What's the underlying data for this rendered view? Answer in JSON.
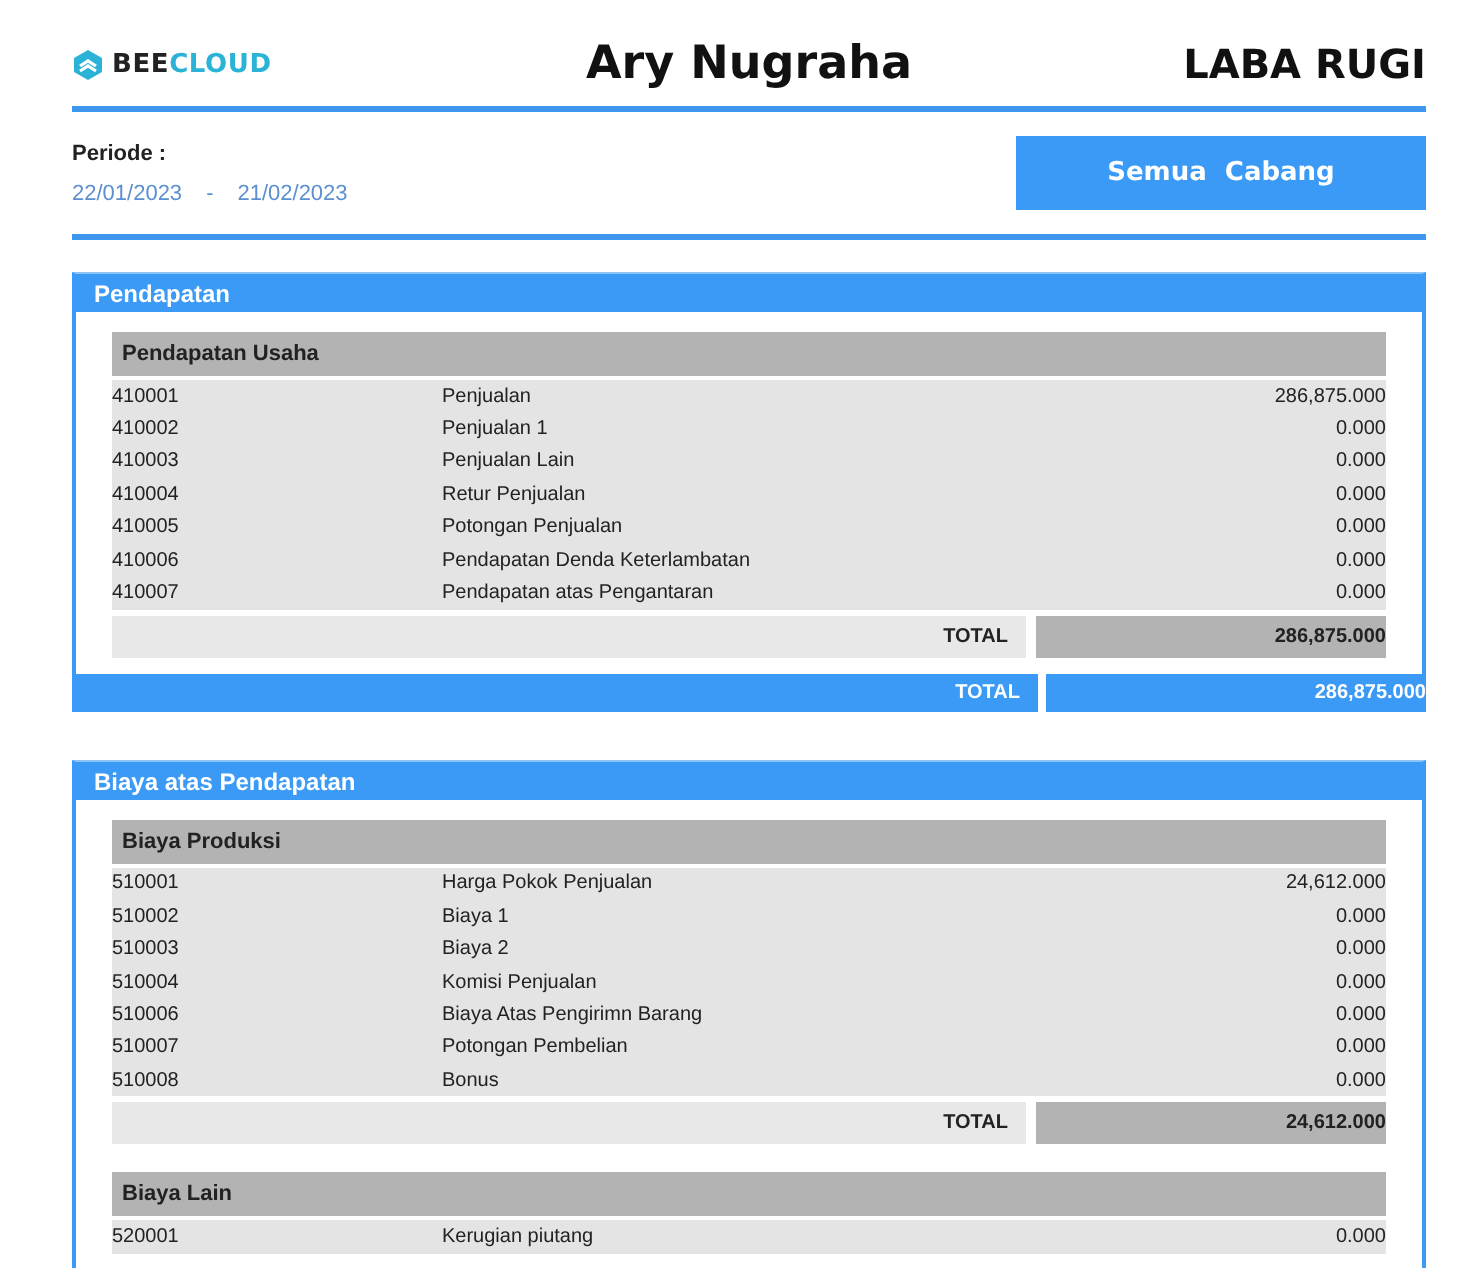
{
  "header": {
    "logo": {
      "first": "BEE",
      "second": "CLOUD"
    },
    "owner": "Ary Nugraha",
    "title": "LABA RUGI"
  },
  "period": {
    "label": "Periode :",
    "start": "22/01/2023",
    "separator": "-",
    "end": "21/02/2023"
  },
  "branch_button": "Semua  Cabang",
  "sections": [
    {
      "title": "Pendapatan",
      "groups": [
        {
          "title": "Pendapatan Usaha",
          "rows": [
            {
              "code": "410001",
              "name": "Penjualan",
              "amount": "286,875.000"
            },
            {
              "code": "410002",
              "name": "Penjualan 1",
              "amount": "0.000"
            },
            {
              "code": "410003",
              "name": "Penjualan Lain",
              "amount": "0.000"
            },
            {
              "code": "410004",
              "name": "Retur Penjualan",
              "amount": "0.000"
            },
            {
              "code": "410005",
              "name": "Potongan Penjualan",
              "amount": "0.000"
            },
            {
              "code": "410006",
              "name": "Pendapatan Denda Keterlambatan",
              "amount": "0.000"
            },
            {
              "code": "410007",
              "name": "Pendapatan atas Pengantaran",
              "amount": "0.000"
            }
          ],
          "total_label": "TOTAL",
          "total": "286,875.000"
        }
      ],
      "total_label": "TOTAL",
      "total": "286,875.000"
    },
    {
      "title": "Biaya atas Pendapatan",
      "groups": [
        {
          "title": "Biaya Produksi",
          "rows": [
            {
              "code": "510001",
              "name": "Harga Pokok Penjualan",
              "amount": "24,612.000"
            },
            {
              "code": "510002",
              "name": "Biaya 1",
              "amount": "0.000"
            },
            {
              "code": "510003",
              "name": "Biaya 2",
              "amount": "0.000"
            },
            {
              "code": "510004",
              "name": "Komisi Penjualan",
              "amount": "0.000"
            },
            {
              "code": "510006",
              "name": "Biaya Atas Pengirimn Barang",
              "amount": "0.000"
            },
            {
              "code": "510007",
              "name": "Potongan Pembelian",
              "amount": "0.000"
            },
            {
              "code": "510008",
              "name": "Bonus",
              "amount": "0.000"
            }
          ],
          "total_label": "TOTAL",
          "total": "24,612.000"
        },
        {
          "title": "Biaya Lain",
          "rows": [
            {
              "code": "520001",
              "name": "Kerugian piutang",
              "amount": "0.000"
            }
          ]
        }
      ]
    }
  ]
}
